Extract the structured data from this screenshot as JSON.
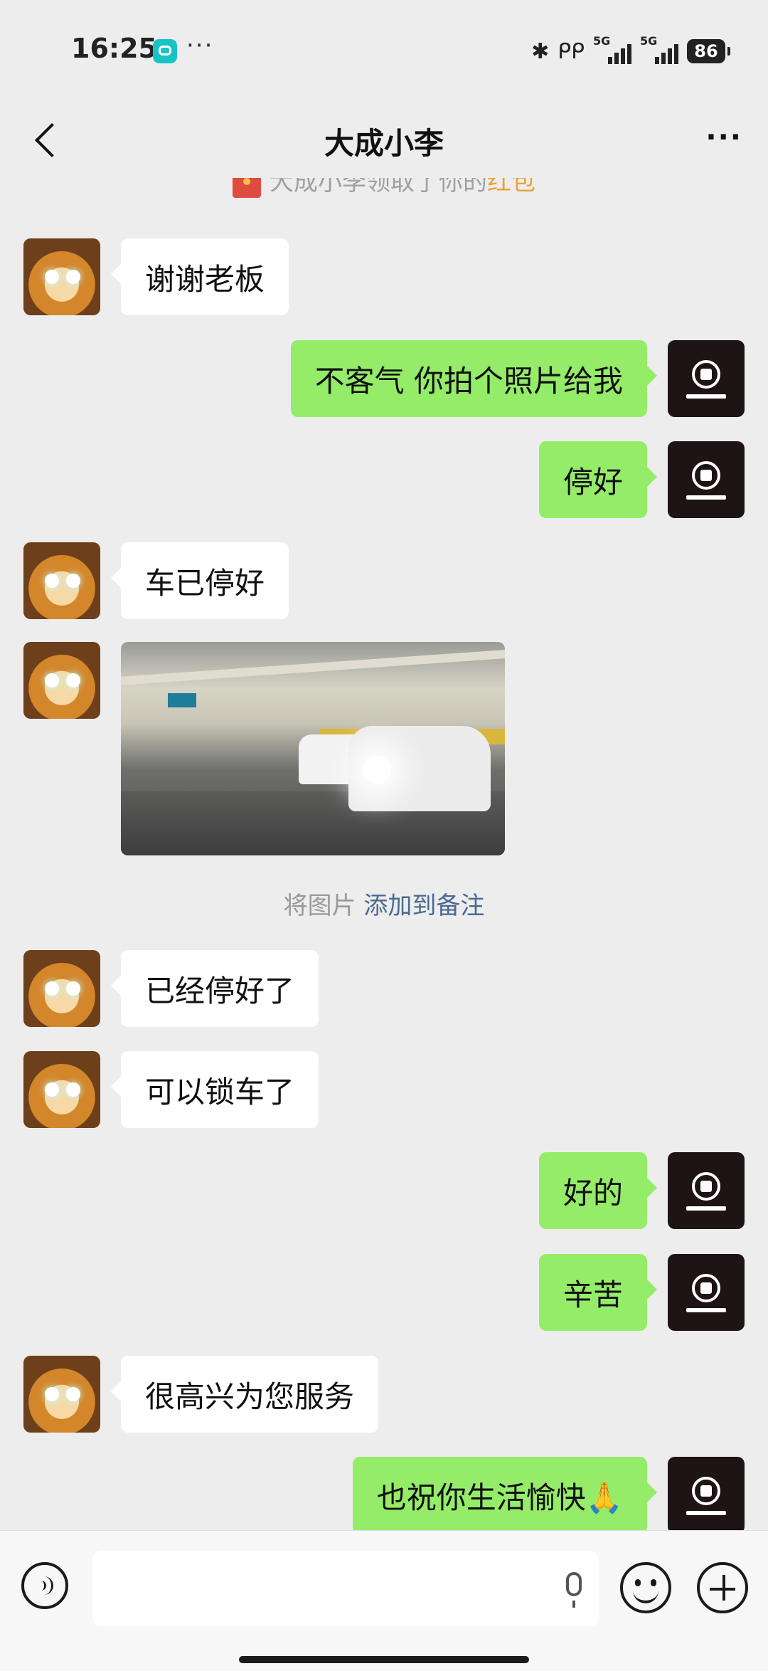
{
  "status_bar": {
    "time": "16:25",
    "more": "···",
    "bluetooth": "✱",
    "earbuds": "ᑭᑭ",
    "net1": "5G",
    "net2": "5G",
    "battery": "86"
  },
  "nav": {
    "title": "大成小李",
    "more": "···"
  },
  "system": {
    "redpacket_prefix": "大成小李领取了你的",
    "redpacket_link": "红包",
    "photo_note_prefix": "将图片",
    "photo_note_link": "添加到备注"
  },
  "messages": [
    {
      "side": "left",
      "text": "谢谢老板"
    },
    {
      "side": "right",
      "text": "不客气 你拍个照片给我"
    },
    {
      "side": "right",
      "text": "停好"
    },
    {
      "side": "left",
      "text": "车已停好"
    },
    {
      "side": "left",
      "type": "image"
    },
    {
      "side": "left",
      "text": "已经停好了"
    },
    {
      "side": "left",
      "text": "可以锁车了"
    },
    {
      "side": "right",
      "text": "好的"
    },
    {
      "side": "right",
      "text": "辛苦"
    },
    {
      "side": "left",
      "text": "很高兴为您服务"
    },
    {
      "side": "right",
      "text": "也祝你生活愉快🙏"
    }
  ],
  "colors": {
    "background": "#ededed",
    "self_bubble": "#95ec69",
    "other_bubble": "#ffffff",
    "link": "#4a6a93",
    "redpacket_link": "#e6a23c"
  }
}
